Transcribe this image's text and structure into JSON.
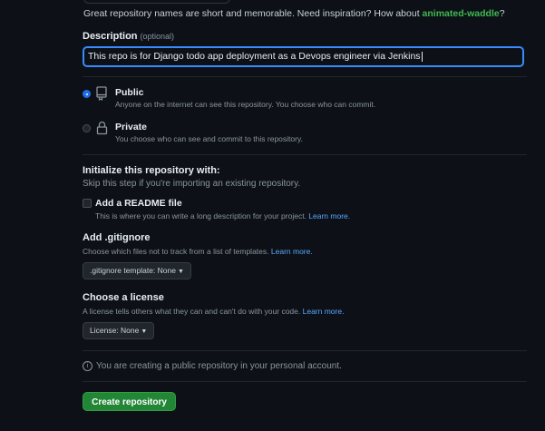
{
  "name_hint": {
    "prefix": "Great repository names are short and memorable. Need inspiration? How about ",
    "suggestion": "animated-waddle",
    "suffix": "?"
  },
  "description": {
    "label": "Description",
    "optional": "(optional)",
    "value": "This repo is for Django todo app deployment as a Devops engineer via Jenkins"
  },
  "visibility": {
    "selected": "Public",
    "options": [
      {
        "title": "Public",
        "desc": "Anyone on the internet can see this repository. You choose who can commit.",
        "icon": "repo-icon"
      },
      {
        "title": "Private",
        "desc": "You choose who can see and commit to this repository.",
        "icon": "lock-icon"
      }
    ]
  },
  "initialize": {
    "title": "Initialize this repository with:",
    "subtitle": "Skip this step if you're importing an existing repository.",
    "readme": {
      "label": "Add a README file",
      "desc": "This is where you can write a long description for your project.",
      "link": "Learn more.",
      "checked": false
    }
  },
  "gitignore": {
    "title": "Add .gitignore",
    "desc": "Choose which files not to track from a list of templates.",
    "link": "Learn more.",
    "select": ".gitignore template: None"
  },
  "license": {
    "title": "Choose a license",
    "desc": "A license tells others what they can and can't do with your code.",
    "link": "Learn more.",
    "select": "License: None"
  },
  "notice": "You are creating a public repository in your personal account.",
  "submit": "Create repository",
  "colors": {
    "background": "#0d1117",
    "primary_button": "#238636",
    "link": "#58a6ff",
    "focus_border": "#388bfd",
    "suggestion": "#3fb950"
  }
}
